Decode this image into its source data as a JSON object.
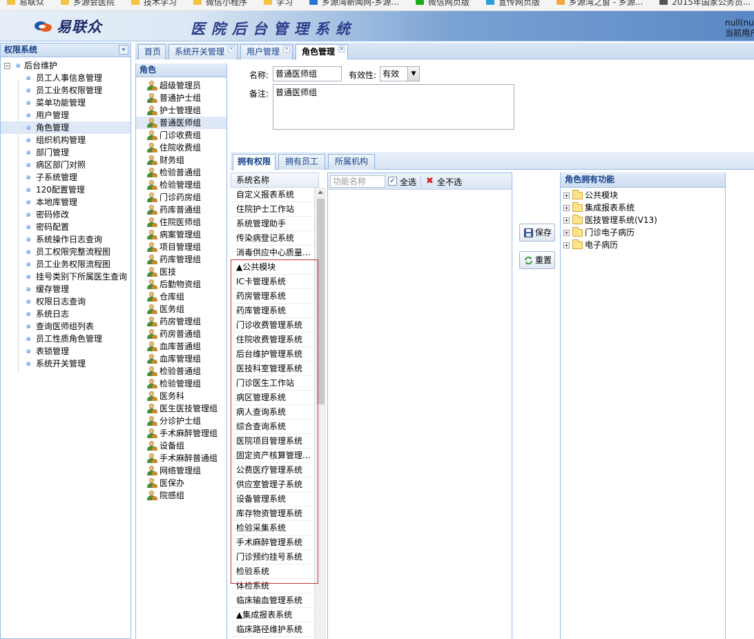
{
  "bookmarks": [
    "易联众",
    "乡源会医院",
    "技术学习",
    "微信小程序",
    "学习",
    "乡源湾新闻网-乡源...",
    "微信网页版",
    "宣传网页版",
    "乡源湾之窗 - 乡源...",
    "2015年国家公务员..."
  ],
  "header": {
    "logo_text": "易联众",
    "system_title": "医院后台管理系统",
    "user_line1": "null(nul",
    "user_line2": "当前用户"
  },
  "left_panel": {
    "title": "权限系统",
    "root": "后台维护",
    "items": [
      "员工人事信息管理",
      "员工业务权限管理",
      "菜单功能管理",
      "用户管理",
      "角色管理",
      "组织机构管理",
      "部门管理",
      "病区部门对照",
      "子系统管理",
      "120配置管理",
      "本地库管理",
      "密码修改",
      "密码配置",
      "系统操作日志查询",
      "员工权限完整流程图",
      "员工业务权限流程图",
      "挂号类别下所属医生查询",
      "缓存管理",
      "权限日志查询",
      "系统日志",
      "查询医师组列表",
      "员工性质角色管理",
      "表锁管理",
      "系统开关管理"
    ],
    "selected_index": 4
  },
  "tabs": [
    "首页",
    "系统开关管理",
    "用户管理",
    "角色管理"
  ],
  "role_panel": {
    "title": "角色",
    "roles": [
      "超级管理员",
      "普通护士组",
      "护士管理组",
      "普通医师组",
      "门诊收费组",
      "住院收费组",
      "财务组",
      "检验普通组",
      "检验管理组",
      "门诊药房组",
      "药库普通组",
      "住院医师组",
      "病案管理组",
      "项目管理组",
      "药库管理组",
      "医技",
      "后勤物资组",
      "仓库组",
      "医务组",
      "药房管理组",
      "药房普通组",
      "血库普通组",
      "血库管理组",
      "检验普通组",
      "检验管理组",
      "医务科",
      "医生医技管理组",
      "分诊护士组",
      "手术麻醉管理组",
      "设备组",
      "手术麻醉普通组",
      "网络管理组",
      "医保办",
      "院感组"
    ],
    "selected_index": 3
  },
  "form": {
    "name_label": "名称:",
    "name_value": "普通医师组",
    "valid_label": "有效性:",
    "valid_value": "有效",
    "note_label": "备注:",
    "note_value": "普通医师组"
  },
  "subtabs": [
    "拥有权限",
    "拥有员工",
    "所属机构"
  ],
  "system_list": {
    "header": "系统名称",
    "items": [
      "自定义报表系统",
      "住院护士工作站",
      "系统管理助手",
      "传染病登记系统",
      "消毒供应中心质量...",
      "▲公共模块",
      "IC卡管理系统",
      "药房管理系统",
      "药库管理系统",
      "门诊收费管理系统",
      "住院收费管理系统",
      "后台维护管理系统",
      "医技科室管理系统",
      "门诊医生工作站",
      "病区管理系统",
      "病人查询系统",
      "综合查询系统",
      "医院项目管理系统",
      "固定资产核算管理...",
      "公费医疗管理系统",
      "供应室管理子系统",
      "设备管理系统",
      "库存物资管理系统",
      "检验采集系统",
      "手术麻醉管理系统",
      "门诊预约挂号系统",
      "检验系统",
      "体检系统",
      "临床输血管理系统",
      "▲集成报表系统",
      "临床路径维护系统"
    ]
  },
  "function_bar": {
    "search_placeholder": "功能名称",
    "select_all": "全选",
    "select_none": "全不选"
  },
  "actions": {
    "save": "保存",
    "reset": "重置"
  },
  "role_functions": {
    "title": "角色拥有功能",
    "items": [
      "公共模块",
      "集成报表系统",
      "医技管理系统(V13)",
      "门诊电子病历",
      "电子病历"
    ]
  }
}
